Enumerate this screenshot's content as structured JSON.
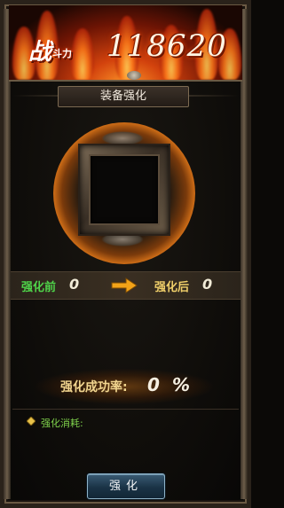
{
  "header": {
    "power_label_main": "战",
    "power_label_small": "斗力",
    "power_value": "118620"
  },
  "panel": {
    "title": "装备强化"
  },
  "compare": {
    "before_label": "强化前",
    "before_value": "0",
    "after_label": "强化后",
    "after_value": "0"
  },
  "success": {
    "label": "强化成功率:",
    "value": "0",
    "unit": "%"
  },
  "cost": {
    "label": "强化消耗:"
  },
  "actions": {
    "enhance_label": "强化"
  },
  "colors": {
    "before_label": "#4fd44a",
    "after_label": "#f0cf6a",
    "cost_label": "#7ed04b",
    "button": "#1a3346"
  },
  "icons": {
    "arrow": "right-arrow-icon",
    "cost": "diamond-icon",
    "slot": "equipment-slot"
  }
}
